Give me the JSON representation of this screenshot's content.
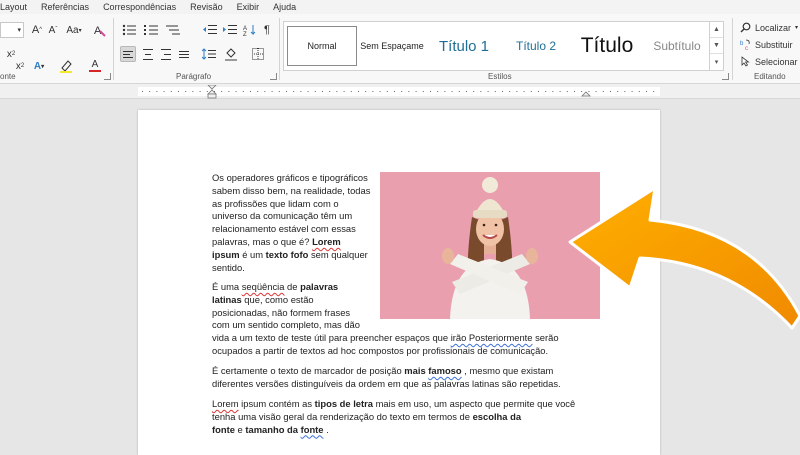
{
  "menu": {
    "tabs": [
      "Layout",
      "Referências",
      "Correspondências",
      "Revisão",
      "Exibir",
      "Ajuda"
    ]
  },
  "ribbon": {
    "font_group_label": "onte",
    "paragraph_group_label": "Parágrafo",
    "styles_group_label": "Estilos",
    "editing_group_label": "Editando",
    "font_size_grow": "A",
    "font_size_shrink": "A",
    "change_case": "Aa",
    "subscript": "x",
    "superscript": "x",
    "text_effects": "A",
    "font_color": "A",
    "pilcrow": "¶",
    "styles": [
      {
        "label": "Normal",
        "selected": true
      },
      {
        "label": "Sem Espaçame",
        "selected": false
      },
      {
        "label": "Título 1",
        "selected": false
      },
      {
        "label": "Título 2",
        "selected": false
      },
      {
        "label": "Título",
        "selected": false
      },
      {
        "label": "Subtítulo",
        "selected": false
      }
    ],
    "editing": {
      "find": "Localizar",
      "replace": "Substituir",
      "select": "Selecionar"
    }
  },
  "document": {
    "p1": {
      "l1": "Os operadores gráficos e tipográficos",
      "l2": "sabem disso bem, na realidade, todas",
      "l3": "as profissões que lidam com o",
      "l4": "universo da comunicação têm um",
      "l5": "relacionamento estável com essas",
      "l6a": "palavras, mas o que é? ",
      "l6b": "Lorem",
      "l7a": "ipsum",
      "l7b": " é um ",
      "l7c": "texto fofo",
      "l7d": " sem qualquer",
      "l8": "sentido."
    },
    "p2": {
      "l1a": "É uma ",
      "l1b": "seqüência",
      "l1c": " de ",
      "l1d": "palavras",
      "l2a": "latinas",
      "l2b": " que, como estão",
      "l3": "posicionadas, não formem frases",
      "l4": "com um sentido completo, mas dão",
      "l5a": "vida a um texto de teste útil para preencher espaços que ",
      "l5b": "irão Posteriormente",
      "l5c": " serão",
      "l6": "ocupados a partir de textos ad hoc compostos por profissionais de comunicação."
    },
    "p3": {
      "l1a": "É certamente o texto de marcador de posição ",
      "l1b": "mais",
      "l1c": " ",
      "l1d": "famoso",
      "l1e": " , mesmo que existam",
      "l2": "diferentes versões distinguíveis da ordem em que as palavras latinas são repetidas."
    },
    "p4": {
      "l1a": "Lorem",
      "l1b": " ipsum contém as ",
      "l1c": "tipos de letra",
      "l1d": " mais em uso, um aspecto que permite que você",
      "l2a": "tenha uma visão geral da renderização do texto em termos de ",
      "l2b": "escolha da",
      "l3a": "fonte",
      "l3b": " e ",
      "l3c": "tamanho da",
      "l3d": " ",
      "l3e": "fonte",
      "l3f": " ."
    }
  },
  "colors": {
    "arrow": "#f7a000",
    "photo_bg": "#ea9fae",
    "heading_blue": "#1f6e96"
  }
}
